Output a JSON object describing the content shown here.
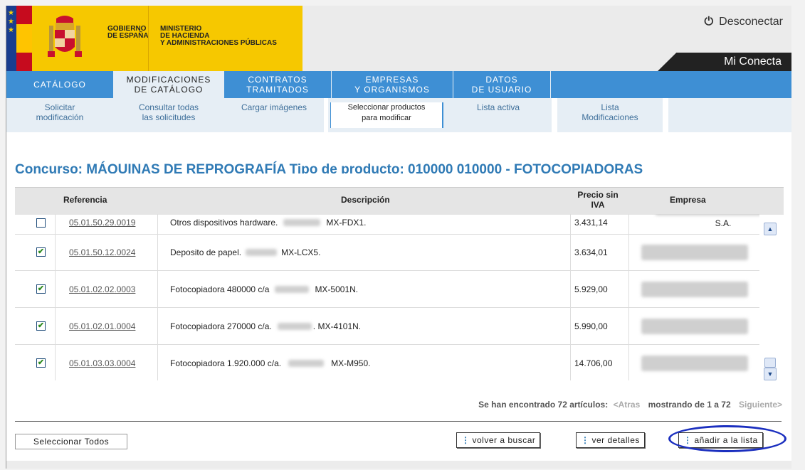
{
  "header": {
    "gobierno": "GOBIERNO\nDE ESPAÑA",
    "ministerio": "MINISTERIO\nDE HACIENDA\nY ADMINISTRACIONES PÚBLICAS",
    "disconnect_label": "Desconectar",
    "miconecta_label": "Mi Conecta",
    "power_icon": "power-icon",
    "colors": {
      "gov_yellow": "#f6c800",
      "nav_blue": "#3e8fd4",
      "title_blue": "#2f7ab5"
    }
  },
  "nav": [
    {
      "label": "CATÁLOGO"
    },
    {
      "label": "MODIFICACIONES\nDE CATÁLOGO",
      "active": true
    },
    {
      "label": "CONTRATOS\nTRAMITADOS"
    },
    {
      "label": "EMPRESAS\nY ORGANISMOS"
    },
    {
      "label": "DATOS\nDE USUARIO"
    }
  ],
  "subnav": [
    {
      "label": "Solicitar\nmodificación"
    },
    {
      "label": "Consultar todas\nlas solicitudes"
    },
    {
      "label": "Cargar imágenes"
    },
    {
      "label": "Seleccionar productos\npara modificar",
      "active": true
    },
    {
      "label": "Lista activa"
    },
    {
      "label": "Lista\nModificaciones"
    }
  ],
  "title": "Concurso: MÁQUINAS DE REPROGRAFÍA Tipo de producto: 010000 010000 - FOTOCOPIADORAS",
  "table": {
    "headers": {
      "referencia": "Referencia",
      "descripcion": "Descripción",
      "precio": "Precio sin\nIVA",
      "empresa": "Empresa"
    },
    "rows": [
      {
        "checked": false,
        "ref": "05.01.50.29.0019",
        "desc": "Otros dispositivos hardware.",
        "model": "MX-FDX1.",
        "price": "3.431,14",
        "empresa": "S.A."
      },
      {
        "checked": true,
        "ref": "05.01.50.12.0024",
        "desc": "Deposito de papel.",
        "model": "MX-LCX5.",
        "price": "3.634,01",
        "empresa": ""
      },
      {
        "checked": true,
        "ref": "05.01.02.02.0003",
        "desc": "Fotocopiadora 480000 c/a",
        "model": "MX-5001N.",
        "price": "5.929,00",
        "empresa": ""
      },
      {
        "checked": true,
        "ref": "05.01.02.01.0004",
        "desc": "Fotocopiadora 270000 c/a.",
        "model": ". MX-4101N.",
        "price": "5.990,00",
        "empresa": ""
      },
      {
        "checked": true,
        "ref": "05.01.03.03.0004",
        "desc": "Fotocopiadora 1.920.000 c/a.",
        "model": "MX-M950.",
        "price": "14.706,00",
        "empresa": ""
      }
    ],
    "check_mark": "✔"
  },
  "pager": {
    "found": "Se han encontrado 72 artículos:",
    "prev": "<Atras",
    "showing": "mostrando de 1 a 72",
    "next": "Siguiente>"
  },
  "buttons": {
    "select_all": "Seleccionar Todos",
    "back_search": "volver a buscar",
    "details": "ver detalles",
    "add_to_list": "añadir a la lista",
    "dots": "⋮"
  }
}
